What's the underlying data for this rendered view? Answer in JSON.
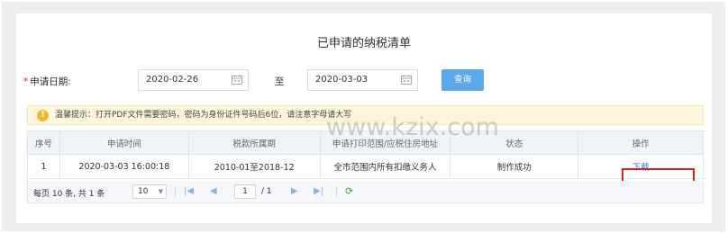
{
  "page": {
    "title": "已申请的纳税清单"
  },
  "filter": {
    "required_mark": "*",
    "date_label": "申请日期:",
    "start_date": "2020-02-26",
    "separator": "至",
    "end_date": "2020-03-03",
    "query_button": "查询"
  },
  "notice": {
    "text": "温馨提示：打开PDF文件需要密码，密码为身份证件号码后6位，请注意字母请大写"
  },
  "table": {
    "headers": [
      "序号",
      "申请时间",
      "税款所属期",
      "申请打印范围/应税住房地址",
      "状态",
      "操作"
    ],
    "rows": [
      {
        "index": "1",
        "apply_time": "2020-03-03 16:00:18",
        "tax_period": "2010-01至2018-12",
        "scope": "全市范围内所有扣缴义务人",
        "status": "制作成功",
        "action": "下载"
      }
    ]
  },
  "pager": {
    "summary": "每页 10 条, 共 1 条",
    "page_size": "10",
    "current_page": "1",
    "total_pages": "/ 1"
  },
  "watermark": "www.kzix.com",
  "colors": {
    "accent": "#5aa9ec",
    "link": "#2a7ed8",
    "highlight_box": "#e01c1c",
    "notice_bg": "#fdf6dc"
  }
}
